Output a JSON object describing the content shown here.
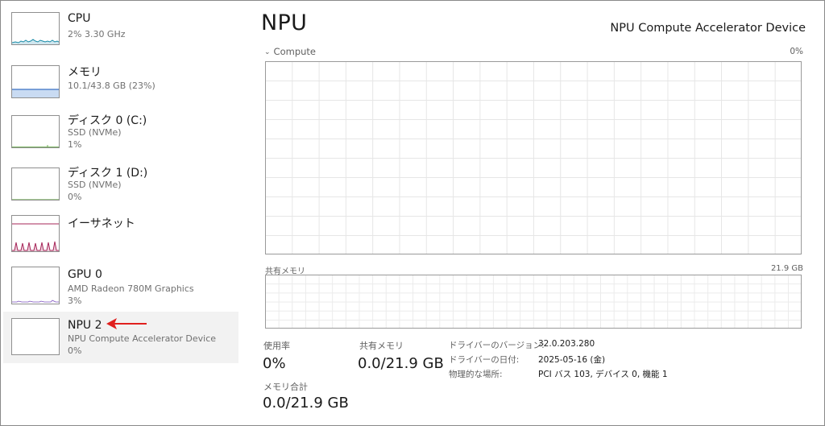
{
  "sidebar": {
    "items": [
      {
        "title": "CPU",
        "sub1": "2%  3.30 GHz",
        "sub2": ""
      },
      {
        "title": "メモリ",
        "sub1": "10.1/43.8 GB (23%)",
        "sub2": ""
      },
      {
        "title": "ディスク 0 (C:)",
        "sub1": "SSD (NVMe)",
        "sub2": "1%"
      },
      {
        "title": "ディスク 1 (D:)",
        "sub1": "SSD (NVMe)",
        "sub2": "0%"
      },
      {
        "title": "イーサネット",
        "sub1": "",
        "sub2": ""
      },
      {
        "title": "GPU 0",
        "sub1": "AMD Radeon 780M Graphics",
        "sub2": "3%"
      },
      {
        "title": "NPU 2",
        "sub1": "NPU Compute Accelerator Device",
        "sub2": "0%"
      }
    ],
    "selected_index": 6
  },
  "colors": {
    "cpu": "#1a8ca8",
    "memory": "#3b72c4",
    "memory_fill": "#c9dbf2",
    "disk": "#4c9a2a",
    "ethernet": "#a7275a",
    "gpu": "#7a4cbd",
    "npu": "#8a8a8a",
    "arrow": "#e0201e"
  },
  "main": {
    "title": "NPU",
    "device_name": "NPU Compute Accelerator Device",
    "compute_label": "Compute",
    "compute_percent": "0%",
    "shared_memory_label": "共有メモリ",
    "shared_memory_max": "21.9 GB"
  },
  "stats": {
    "utilization_label": "使用率",
    "utilization_value": "0%",
    "shared_label": "共有メモリ",
    "shared_value": "0.0/21.9 GB",
    "total_label": "メモリ合計",
    "total_value": "0.0/21.9 GB"
  },
  "info": [
    {
      "key": "ドライバーのバージョン:",
      "value": "32.0.203.280"
    },
    {
      "key": "ドライバーの日付:",
      "value": "2025-05-16 (金)"
    },
    {
      "key": "物理的な場所:",
      "value": "PCI バス 103, デバイス 0, 機能 1"
    }
  ]
}
